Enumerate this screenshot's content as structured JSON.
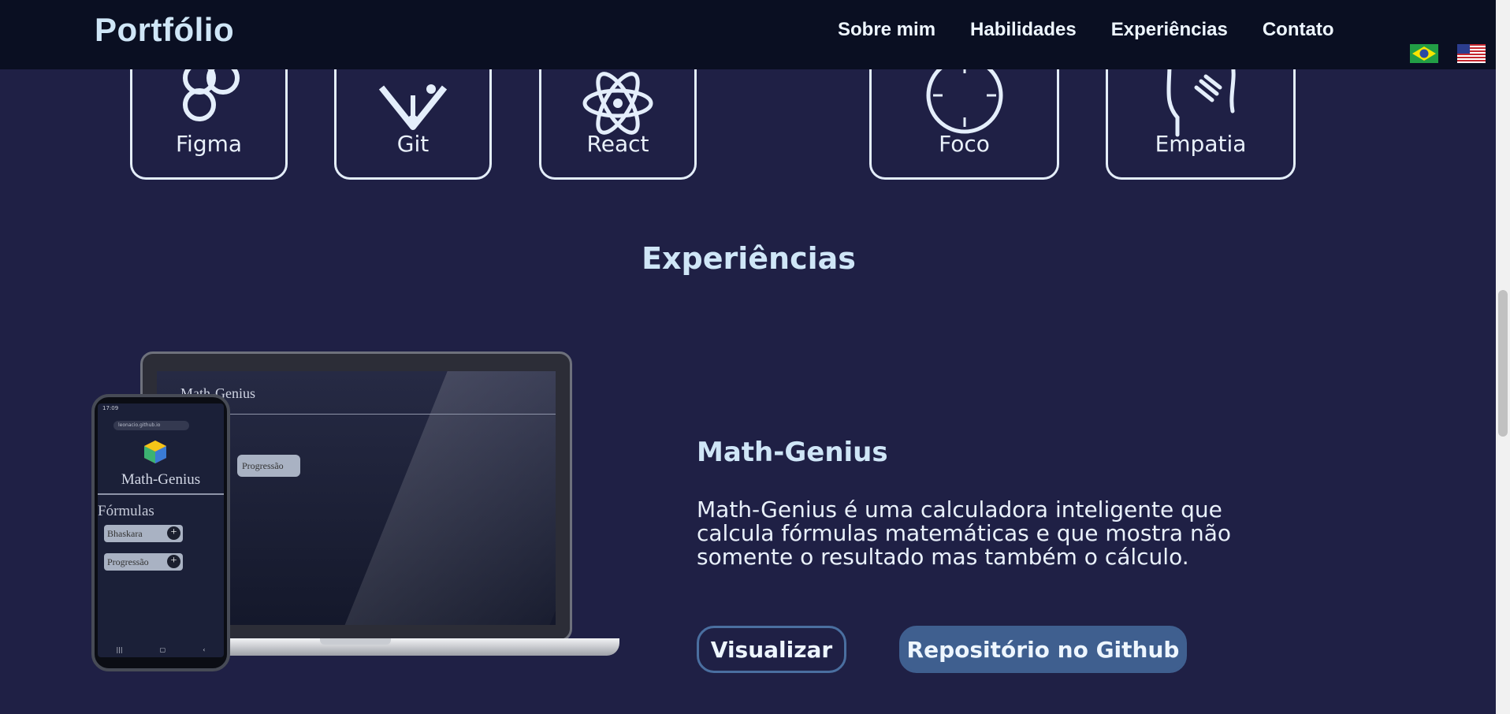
{
  "header": {
    "logo": "Portfólio",
    "nav": [
      "Sobre mim",
      "Habilidades",
      "Experiências",
      "Contato"
    ],
    "languages": [
      {
        "icon": "brazil-flag-icon",
        "code": "pt-BR"
      },
      {
        "icon": "us-flag-icon",
        "code": "en-US"
      }
    ]
  },
  "skills": {
    "hard": [
      {
        "label": "Figma",
        "icon": "figma-icon"
      },
      {
        "label": "Git",
        "icon": "git-icon"
      },
      {
        "label": "React",
        "icon": "react-icon"
      }
    ],
    "soft": [
      {
        "label": "Foco",
        "icon": "focus-icon"
      },
      {
        "label": "Empatia",
        "icon": "empathy-icon"
      }
    ]
  },
  "experiences": {
    "title": "Experiências",
    "project": {
      "name": "Math-Genius",
      "description": "Math-Genius é uma calculadora inteligente que calcula fórmulas matemáticas e que mostra não somente o resultado mas também o cálculo.",
      "buttons": {
        "view": "Visualizar",
        "repo": "Repositório no Github"
      },
      "mockup": {
        "laptop_title": "Math-Genius",
        "laptop_button": "Progressão",
        "phone_status": "17:09",
        "phone_url": "leonacio.github.io",
        "phone_title": "Math-Genius",
        "phone_section": "Fórmulas",
        "phone_buttons": [
          "Bhaskara",
          "Progressão"
        ]
      }
    }
  },
  "colors": {
    "background": "#1f2045",
    "header": "#0a0f22",
    "accent": "#3f5f8f",
    "text_heading": "#cfe6f7"
  }
}
